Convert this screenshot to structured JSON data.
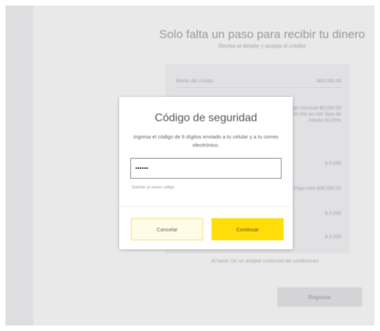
{
  "page": {
    "heading": "Solo falta un paso para recibir tu dinero",
    "subheading": "Revisa el detalle y acepta el crédito",
    "disclaimer": "Al hacer clic en aceptar confirmas las condiciones",
    "back_button": "Regresar"
  },
  "summary": {
    "rows": [
      {
        "label": "Monto del crédito",
        "value": "$00,000.00"
      }
    ],
    "blocks": [
      {
        "text": "Pago mensual $0,000.00 CAT 00.0% sin IVA Tasa de interés 00.00%"
      },
      {
        "text": "$ 0,000"
      },
      {
        "text": "Pago total $00,000.00"
      },
      {
        "text": "$ 0,000"
      },
      {
        "text": "$ 0,000"
      }
    ]
  },
  "modal": {
    "title": "Código de seguridad",
    "description": "Ingresa el código de 6 dígitos enviado a tu celular y a tu correo electrónico.",
    "code_value": "••••••",
    "resend_link": "Solicitar un nuevo código",
    "cancel_label": "Cancelar",
    "continue_label": "Continuar"
  },
  "colors": {
    "accent": "#fedd0b",
    "overlay": "#e9e9ea",
    "modal_bg": "#ffffff"
  }
}
